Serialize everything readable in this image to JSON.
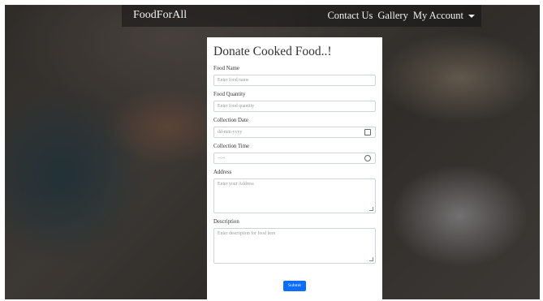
{
  "navbar": {
    "brand": "FoodForAll",
    "links": [
      "Contact Us",
      "Gallery",
      "My Account"
    ]
  },
  "form": {
    "title": "Donate Cooked Food..!",
    "fields": {
      "food_name": {
        "label": "Food Name",
        "placeholder": "Enter food name"
      },
      "food_quantity": {
        "label": "Food Quantity",
        "placeholder": "Enter food quantity"
      },
      "collection_date": {
        "label": "Collection Date",
        "placeholder": "dd-mm-yyyy"
      },
      "collection_time": {
        "label": "Collection Time",
        "placeholder": "--:--"
      },
      "address": {
        "label": "Address",
        "placeholder": "Enter your Address"
      },
      "description": {
        "label": "Description",
        "placeholder": "Enter description for food here"
      }
    },
    "submit_label": "Submit"
  },
  "icons": {
    "calendar": "calendar-icon",
    "clock": "clock-icon",
    "caret": "caret-down-icon"
  },
  "colors": {
    "submit_button": "#0d6efd",
    "navbar_text": "#f2f2f2"
  }
}
